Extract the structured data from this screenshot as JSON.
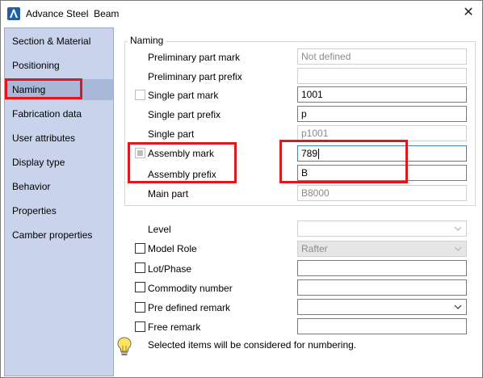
{
  "window": {
    "app_title": "Advance Steel",
    "object_title": "Beam",
    "close_glyph": "✕",
    "accent_color": "#1f5fa8"
  },
  "sidebar": {
    "selected": "Naming",
    "items": [
      {
        "label": "Section & Material"
      },
      {
        "label": "Positioning"
      },
      {
        "label": "Naming"
      },
      {
        "label": "Fabrication data"
      },
      {
        "label": "User attributes"
      },
      {
        "label": "Display type"
      },
      {
        "label": "Behavior"
      },
      {
        "label": "Properties"
      },
      {
        "label": "Camber properties"
      }
    ]
  },
  "naming": {
    "group_title": "Naming",
    "preliminary_part_mark": {
      "label": "Preliminary part mark",
      "value": "Not defined"
    },
    "preliminary_part_prefix": {
      "label": "Preliminary part prefix",
      "value": ""
    },
    "single_part_mark": {
      "label": "Single part mark",
      "value": "1001",
      "checked": false
    },
    "single_part_prefix": {
      "label": "Single part prefix",
      "value": "p"
    },
    "single_part": {
      "label": "Single part",
      "value": "p1001"
    },
    "assembly_mark": {
      "label": "Assembly mark",
      "value": "789",
      "checked": "indeterminate"
    },
    "assembly_prefix": {
      "label": "Assembly prefix",
      "value": "B"
    },
    "main_part": {
      "label": "Main part",
      "value": "B8000"
    }
  },
  "other": {
    "level": {
      "label": "Level",
      "value": ""
    },
    "model_role": {
      "label": "Model Role",
      "value": "Rafter",
      "checked": false
    },
    "lot_phase": {
      "label": "Lot/Phase",
      "value": "",
      "checked": false
    },
    "commodity_number": {
      "label": "Commodity number",
      "value": "",
      "checked": false
    },
    "pre_defined_remark": {
      "label": "Pre defined remark",
      "value": "",
      "checked": false
    },
    "free_remark": {
      "label": "Free remark",
      "value": "",
      "checked": false
    }
  },
  "hint": {
    "text": "Selected items will be considered for numbering.",
    "icon": "lightbulb-icon"
  },
  "annotations": {
    "highlight_color": "#e3161b"
  }
}
